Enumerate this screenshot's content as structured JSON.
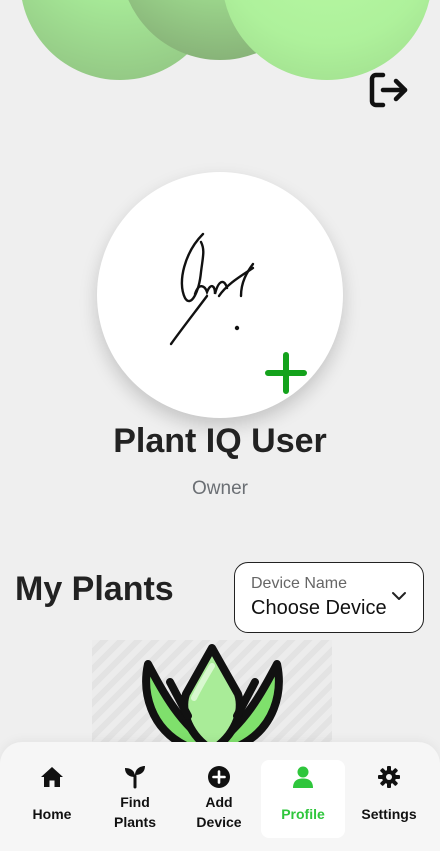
{
  "colors": {
    "accent": "#2fc63c",
    "header_bubble": "#a5e796",
    "background": "#efefef",
    "add_icon": "#14a21c"
  },
  "header": {
    "logout_icon": "logout-icon"
  },
  "profile": {
    "name": "Plant IQ User",
    "role": "Owner",
    "avatar_icon": "signature-image",
    "add_photo_icon": "plus-icon"
  },
  "plants": {
    "title": "My Plants",
    "device_select": {
      "label": "Device Name",
      "value": "Choose Device",
      "icon": "chevron-down-icon"
    }
  },
  "nav": {
    "items": [
      {
        "label": "Home",
        "icon": "home-icon"
      },
      {
        "label": "Find Plants",
        "icon": "sprout-icon"
      },
      {
        "label": "Add Device",
        "icon": "add-circle-icon"
      },
      {
        "label": "Profile",
        "icon": "person-icon",
        "active": true
      },
      {
        "label": "Settings",
        "icon": "gear-icon"
      }
    ]
  }
}
